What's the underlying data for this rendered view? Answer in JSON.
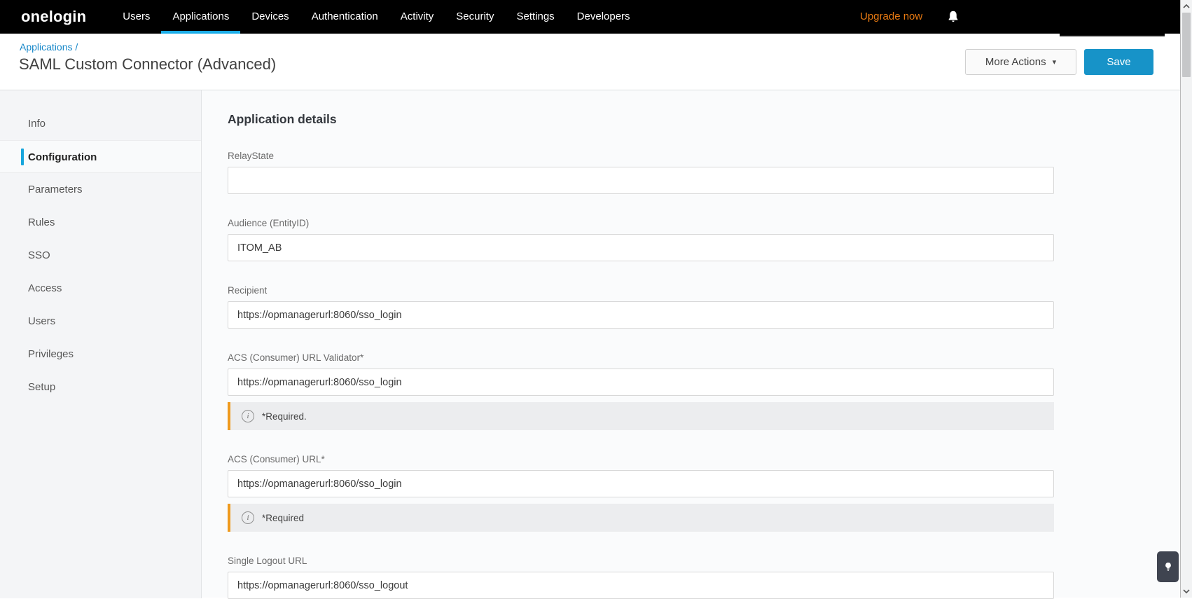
{
  "navbar": {
    "logo": "onelogin",
    "items": [
      {
        "label": "Users",
        "active": false
      },
      {
        "label": "Applications",
        "active": true
      },
      {
        "label": "Devices",
        "active": false
      },
      {
        "label": "Authentication",
        "active": false
      },
      {
        "label": "Activity",
        "active": false
      },
      {
        "label": "Security",
        "active": false
      },
      {
        "label": "Settings",
        "active": false
      },
      {
        "label": "Developers",
        "active": false
      }
    ],
    "upgrade_label": "Upgrade now"
  },
  "header": {
    "breadcrumb": "Applications /",
    "title": "SAML Custom Connector (Advanced)",
    "more_actions_label": "More Actions",
    "save_label": "Save"
  },
  "sidebar": {
    "items": [
      {
        "label": "Info",
        "active": false
      },
      {
        "label": "Configuration",
        "active": true
      },
      {
        "label": "Parameters",
        "active": false
      },
      {
        "label": "Rules",
        "active": false
      },
      {
        "label": "SSO",
        "active": false
      },
      {
        "label": "Access",
        "active": false
      },
      {
        "label": "Users",
        "active": false
      },
      {
        "label": "Privileges",
        "active": false
      },
      {
        "label": "Setup",
        "active": false
      }
    ]
  },
  "main": {
    "section_title": "Application details",
    "fields": [
      {
        "label": "RelayState",
        "value": ""
      },
      {
        "label": "Audience (EntityID)",
        "value": "ITOM_AB"
      },
      {
        "label": "Recipient",
        "value": "https://opmanagerurl:8060/sso_login"
      },
      {
        "label": "ACS (Consumer) URL Validator*",
        "value": "https://opmanagerurl:8060/sso_login",
        "note": "*Required."
      },
      {
        "label": "ACS (Consumer) URL*",
        "value": "https://opmanagerurl:8060/sso_login",
        "note": "*Required"
      },
      {
        "label": "Single Logout URL",
        "value": "https://opmanagerurl:8060/sso_logout"
      }
    ]
  },
  "icons": {
    "info_glyph": "i",
    "more_actions_caret": "▾"
  },
  "colors": {
    "navbar_bg": "#000000",
    "nav_active_underline": "#1badE8",
    "upgrade_orange": "#e87a12",
    "breadcrumb_blue": "#1687c9",
    "save_blue": "#1793c8",
    "sidebar_active_bar": "#17a5dc",
    "note_border_orange": "#ef9a1e",
    "note_bg": "#ecedef"
  }
}
